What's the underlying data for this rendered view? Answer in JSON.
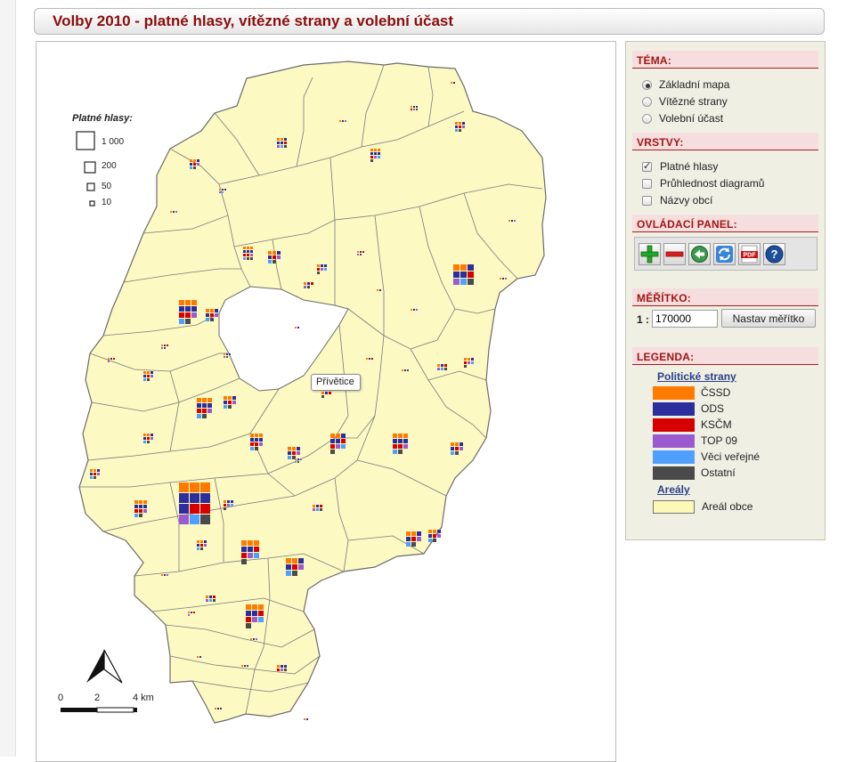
{
  "page": {
    "title": "Volby 2010 - platné hlasy, vítězné strany a volební účast"
  },
  "map": {
    "tooltip": "Přívětice",
    "size_legend": {
      "title": "Platné hlasy:",
      "entries": [
        "1 000",
        "200",
        "50",
        "10"
      ]
    },
    "scalebar": {
      "labels": [
        "0",
        "2",
        "4 km"
      ]
    },
    "north_arrow": "north-arrow-icon"
  },
  "sidebar": {
    "theme": {
      "heading": "TÉMA:",
      "options": [
        {
          "label": "Základní mapa",
          "selected": true
        },
        {
          "label": "Vítězné strany",
          "selected": false
        },
        {
          "label": "Volební účast",
          "selected": false
        }
      ]
    },
    "layers": {
      "heading": "VRSTVY:",
      "items": [
        {
          "label": "Platné hlasy",
          "checked": true
        },
        {
          "label": "Průhlednost diagramů",
          "checked": false
        },
        {
          "label": "Názvy obcí",
          "checked": false
        }
      ]
    },
    "control_panel": {
      "heading": "OVLÁDACÍ PANEL:",
      "tools": [
        "zoom-in-icon",
        "zoom-out-icon",
        "back-icon",
        "refresh-icon",
        "pdf-icon",
        "help-icon"
      ],
      "pdf_text": "PDF",
      "help_text": "?"
    },
    "scale": {
      "heading": "MĚŘÍTKO:",
      "prefix": "1 :",
      "value": "170000",
      "button": "Nastav měřítko"
    },
    "legend": {
      "heading": "LEGENDA:",
      "parties_title": "Politické strany",
      "parties": [
        {
          "name": "ČSSD",
          "color": "#ff7a00"
        },
        {
          "name": "ODS",
          "color": "#2b2e9c"
        },
        {
          "name": "KSČM",
          "color": "#d70000"
        },
        {
          "name": "TOP 09",
          "color": "#9a5ad0"
        },
        {
          "name": "Věci veřejné",
          "color": "#4f9fff"
        },
        {
          "name": "Ostatní",
          "color": "#4a4a4a"
        }
      ],
      "areas_title": "Areály",
      "area_label": "Areál obce",
      "area_color": "#fcf9b6"
    }
  }
}
